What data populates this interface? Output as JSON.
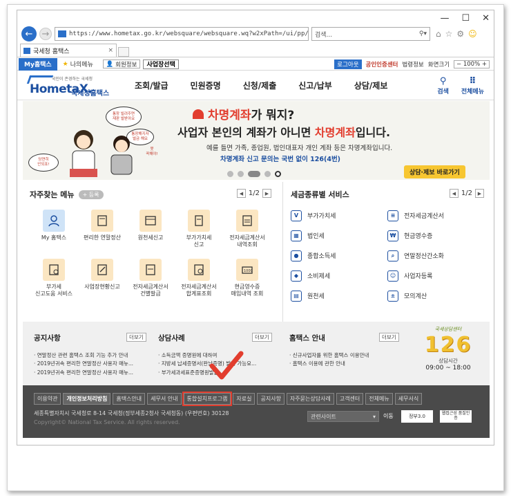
{
  "browser": {
    "url": "https://www.hometax.go.kr/websquare/websquare.wq?w2xPath=/ui/pp/index.xml&tmIdx=0",
    "search_placeholder": "검색...",
    "tab_title": "국세청 홈택스"
  },
  "util": {
    "myhome": "My홈택스",
    "mymenu": "나의메뉴",
    "member_info": "회원정보",
    "business": "사업장선택",
    "logout": "로그아웃",
    "cert_center": "공인인증센터",
    "law": "법령정보",
    "screen_size": "화면크기",
    "zoom": "100%"
  },
  "header": {
    "logo_tiny": "국민이 존경하는 국세청",
    "logo_name": "HometaX.",
    "logo_sub": "국세청홈택스",
    "gnb": [
      "조회/발급",
      "민원증명",
      "신청/제출",
      "신고/납부",
      "상담/제보"
    ],
    "search": "검색",
    "allmenu": "전체메뉴"
  },
  "banner": {
    "bubble1": "통장 빌려주면\n재판 벌받아요",
    "bubble2": "통장해지자\n벌금 해요",
    "bubble3": "당연히\n안되죠!",
    "bubble4": "못\n꼭해야!",
    "head_red": "차명계좌",
    "head_black": "가 뭐지?",
    "line2_a": "사업자 본인의 계좌가 아니면 ",
    "line2_red": "차명계좌",
    "line2_b": "입니다.",
    "line3": "예를 들면 가족, 종업원, 법인대표자 개인 계좌 등은 차명계좌입니다.",
    "line4": "차명계좌 신고 문의는 국번 없이 126(4번)",
    "consult": "상담·제보 바로가기"
  },
  "favorites": {
    "title": "자주찾는 메뉴",
    "add": "+ 등록",
    "page": "1/2",
    "items": [
      "My 홈택스",
      "편리한 연말정산",
      "원천세신고",
      "부가가치세\n신고",
      "전자세금계산서\n내역조회",
      "부가세\n신고도움 서비스",
      "사업장현황신고",
      "전자세금계산서\n건별발급",
      "전자세금계산서\n합계표조회",
      "현금영수증\n매입내역 조회"
    ]
  },
  "taxservice": {
    "title": "세금종류별 서비스",
    "page": "1/2",
    "items": [
      "부가가치세",
      "전자세금계산서",
      "법인세",
      "현금영수증",
      "종합소득세",
      "연말정산간소화",
      "소비제세",
      "사업자등록",
      "원천세",
      "모의계산"
    ]
  },
  "notice": {
    "title": "공지사항",
    "more": "더보기",
    "items": [
      "연말정산 관련 홈택스 조회 기능 추가 안내",
      "2019년귀속 편리한 연말정산 사용자 매뉴...",
      "2019년귀속 편리한 연말정산 사용자 매뉴..."
    ]
  },
  "cases": {
    "title": "상담사례",
    "more": "더보기",
    "items": [
      "소득금액 증명원에 대하여",
      "지방세 납세증명서(완납증명) 발행 가능요...",
      "부가세과세표준증명원발급"
    ]
  },
  "hometax_guide": {
    "title": "홈택스 안내",
    "more": "더보기",
    "items": [
      "신규사업자를 위한 홈택스 이용안내",
      "홈택스 이용에 관한 안내"
    ]
  },
  "center126": {
    "label": "국세상담센터",
    "number": "126",
    "hours_label": "상담시간",
    "hours": "09:00 ~ 18:00"
  },
  "footer": {
    "links": [
      "이용약관",
      "개인정보처리방침",
      "홈택스안내",
      "세무서 안내",
      "통합설치프로그램",
      "자료실",
      "공지사항",
      "자주묻는상담사례",
      "고객센터",
      "전체메뉴",
      "세무서식"
    ],
    "address": "세종특별자치시 국세청로 8-14 국세청(정부세종2청사 국세청동) (우편번호) 30128",
    "copyright": "Copyright© National Tax Service. All rights reserved.",
    "related": "관련사이트",
    "go": "이동",
    "badge1": "정부3.0",
    "badge2": "웹접근성 품질인증"
  },
  "colors": {
    "brand_blue": "#2a6fc9",
    "accent_red": "#e23d2e",
    "consult_yellow": "#f7c631"
  }
}
